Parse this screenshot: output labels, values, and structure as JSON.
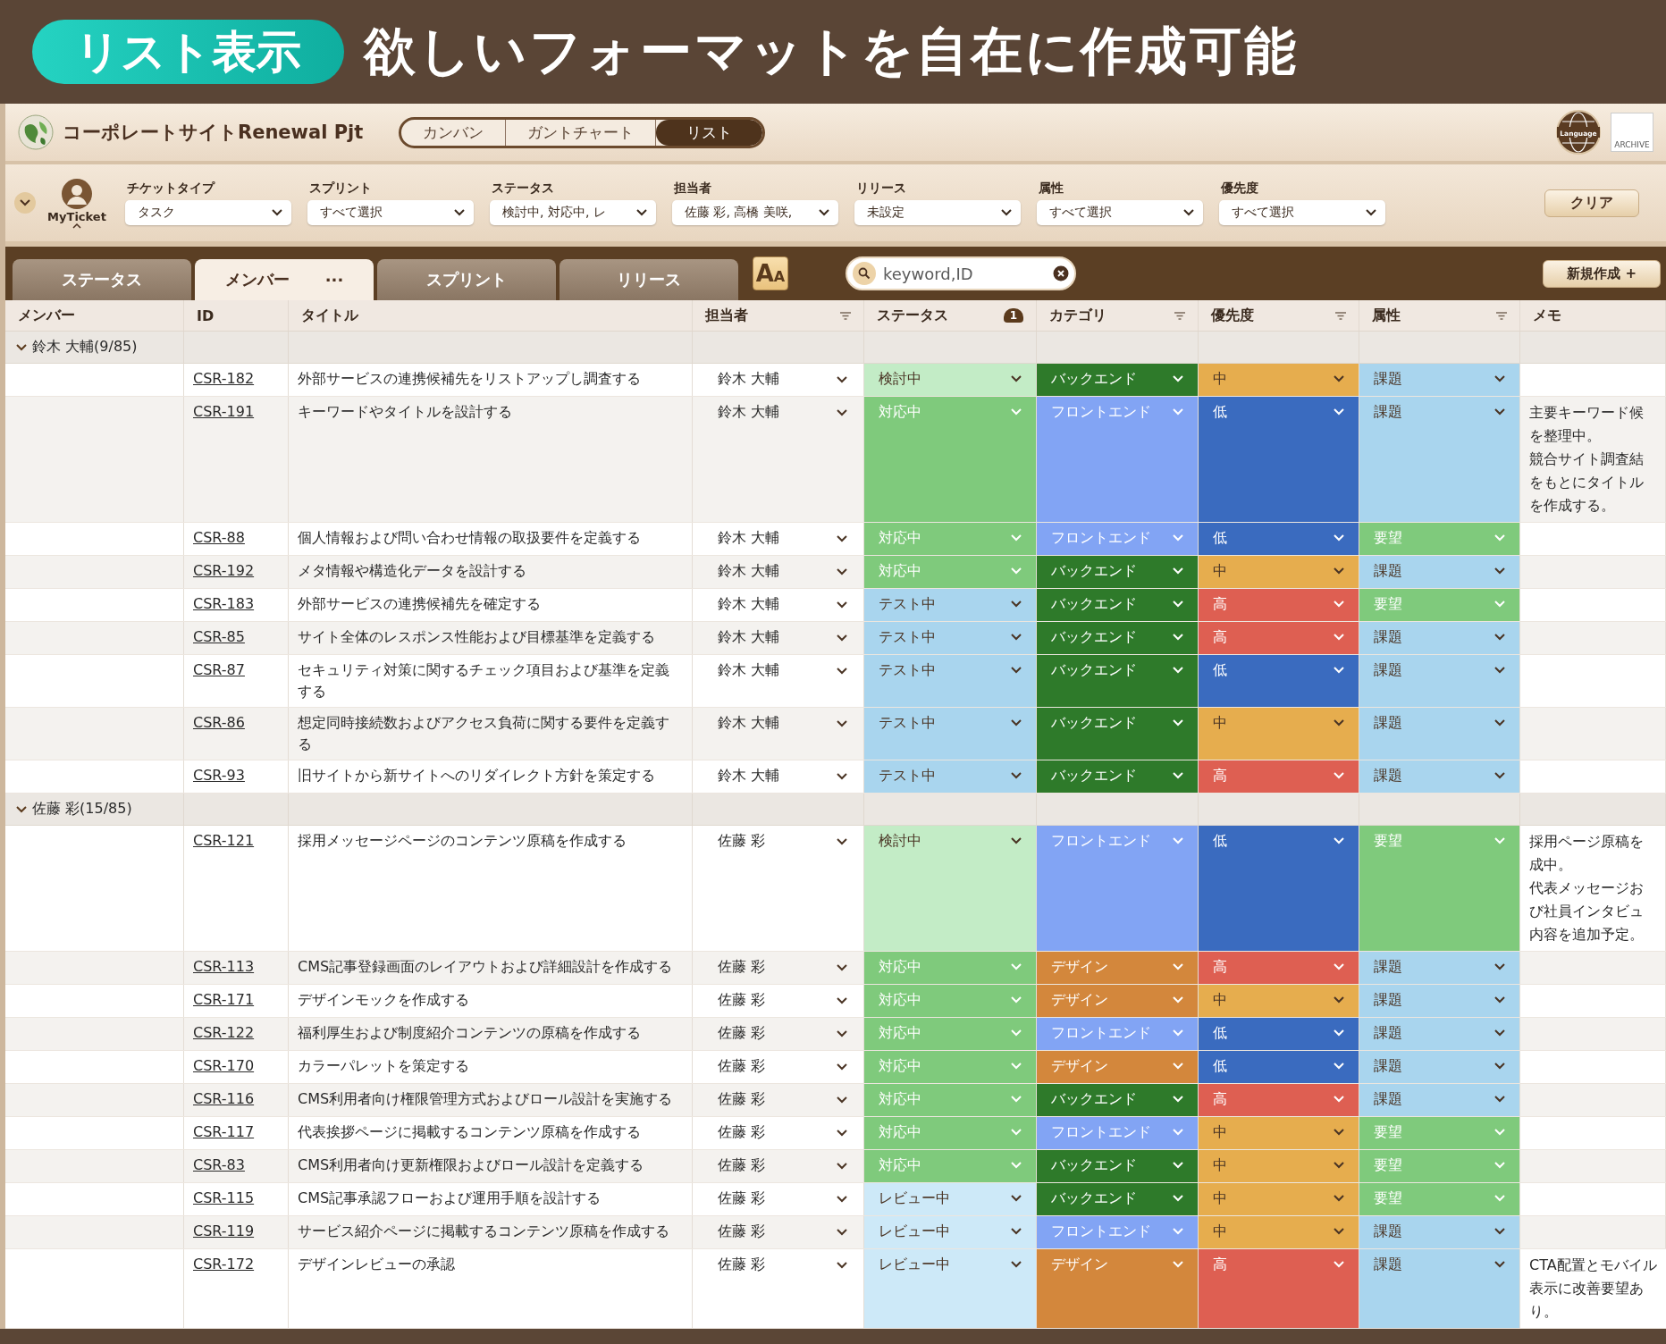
{
  "banner": {
    "tag": "リスト表示",
    "headline": "欲しいフォーマットを自在に作成可能"
  },
  "header": {
    "project": "コーポレートサイトRenewal Pjt",
    "views": [
      {
        "label": "カンバン",
        "selected": false
      },
      {
        "label": "ガントチャート",
        "selected": false
      },
      {
        "label": "リスト",
        "selected": true
      }
    ],
    "language": "Language",
    "archive": "ARCHIVE"
  },
  "filters": {
    "my_ticket": "MyTicket",
    "items": [
      {
        "label": "チケットタイプ",
        "value": "タスク"
      },
      {
        "label": "スプリント",
        "value": "すべて選択"
      },
      {
        "label": "ステータス",
        "value": "検討中, 対応中, レ"
      },
      {
        "label": "担当者",
        "value": "佐藤 彩, 高橋 美咲,"
      },
      {
        "label": "リリース",
        "value": "未設定"
      },
      {
        "label": "属性",
        "value": "すべて選択"
      },
      {
        "label": "優先度",
        "value": "すべて選択"
      }
    ],
    "clear": "クリア"
  },
  "tabs": [
    {
      "label": "ステータス",
      "selected": false
    },
    {
      "label": "メンバー",
      "selected": true,
      "menu": "···"
    },
    {
      "label": "スプリント",
      "selected": false
    },
    {
      "label": "リリース",
      "selected": false
    }
  ],
  "font_button": "AA",
  "search": {
    "placeholder": "keyword,ID"
  },
  "new_button": "新規作成 +",
  "table": {
    "columns": [
      {
        "label": "メンバー",
        "filter": false
      },
      {
        "label": "ID",
        "filter": false
      },
      {
        "label": "タイトル",
        "filter": false
      },
      {
        "label": "担当者",
        "filter": true
      },
      {
        "label": "ステータス",
        "filter": false,
        "badge": "1"
      },
      {
        "label": "カテゴリ",
        "filter": true
      },
      {
        "label": "優先度",
        "filter": true
      },
      {
        "label": "属性",
        "filter": true
      },
      {
        "label": "メモ",
        "filter": false
      }
    ],
    "groups": [
      {
        "label": "鈴木 大輔(9/85)",
        "expanded": true,
        "rows": [
          {
            "id": "CSR-182",
            "title": "外部サービスの連携候補先をリストアップし調査する",
            "assignee": "鈴木 大輔",
            "status": {
              "value": "検討中",
              "color": "#c3ecc6"
            },
            "category": {
              "value": "バックエンド",
              "color": "#2e7a2a"
            },
            "priority": {
              "value": "中",
              "color": "#e6ad4e"
            },
            "attribute": {
              "value": "課題",
              "color": "#a9d5ee"
            }
          },
          {
            "id": "CSR-191",
            "title": "キーワードやタイトルを設計する",
            "assignee": "鈴木 大輔",
            "status": {
              "value": "対応中",
              "color": "#7fca7c"
            },
            "category": {
              "value": "フロントエンド",
              "color": "#82a4f4"
            },
            "priority": {
              "value": "低",
              "color": "#3a6bbf"
            },
            "attribute": {
              "value": "課題",
              "color": "#a9d5ee"
            },
            "memo": [
              "主要キーワード候",
              "を整理中。",
              "競合サイト調査結",
              "をもとにタイトル",
              "を作成する。"
            ]
          },
          {
            "id": "CSR-88",
            "title": "個人情報および問い合わせ情報の取扱要件を定義する",
            "assignee": "鈴木 大輔",
            "status": {
              "value": "対応中",
              "color": "#7fca7c"
            },
            "category": {
              "value": "フロントエンド",
              "color": "#82a4f4"
            },
            "priority": {
              "value": "低",
              "color": "#3a6bbf"
            },
            "attribute": {
              "value": "要望",
              "color": "#7fca7c"
            }
          },
          {
            "id": "CSR-192",
            "title": "メタ情報や構造化データを設計する",
            "assignee": "鈴木 大輔",
            "status": {
              "value": "対応中",
              "color": "#7fca7c"
            },
            "category": {
              "value": "バックエンド",
              "color": "#2e7a2a"
            },
            "priority": {
              "value": "中",
              "color": "#e6ad4e"
            },
            "attribute": {
              "value": "課題",
              "color": "#a9d5ee"
            }
          },
          {
            "id": "CSR-183",
            "title": "外部サービスの連携候補先を確定する",
            "assignee": "鈴木 大輔",
            "status": {
              "value": "テスト中",
              "color": "#a9d5ee"
            },
            "category": {
              "value": "バックエンド",
              "color": "#2e7a2a"
            },
            "priority": {
              "value": "高",
              "color": "#de5f52"
            },
            "attribute": {
              "value": "要望",
              "color": "#7fca7c"
            }
          },
          {
            "id": "CSR-85",
            "title": "サイト全体のレスポンス性能および目標基準を定義する",
            "assignee": "鈴木 大輔",
            "status": {
              "value": "テスト中",
              "color": "#a9d5ee"
            },
            "category": {
              "value": "バックエンド",
              "color": "#2e7a2a"
            },
            "priority": {
              "value": "高",
              "color": "#de5f52"
            },
            "attribute": {
              "value": "課題",
              "color": "#a9d5ee"
            }
          },
          {
            "id": "CSR-87",
            "title": "セキュリティ対策に関するチェック項目および基準を定義する",
            "assignee": "鈴木 大輔",
            "status": {
              "value": "テスト中",
              "color": "#a9d5ee"
            },
            "category": {
              "value": "バックエンド",
              "color": "#2e7a2a"
            },
            "priority": {
              "value": "低",
              "color": "#3a6bbf"
            },
            "attribute": {
              "value": "課題",
              "color": "#a9d5ee"
            }
          },
          {
            "id": "CSR-86",
            "title": "想定同時接続数およびアクセス負荷に関する要件を定義する",
            "assignee": "鈴木 大輔",
            "status": {
              "value": "テスト中",
              "color": "#a9d5ee"
            },
            "category": {
              "value": "バックエンド",
              "color": "#2e7a2a"
            },
            "priority": {
              "value": "中",
              "color": "#e6ad4e"
            },
            "attribute": {
              "value": "課題",
              "color": "#a9d5ee"
            }
          },
          {
            "id": "CSR-93",
            "title": "旧サイトから新サイトへのリダイレクト方針を策定する",
            "assignee": "鈴木 大輔",
            "status": {
              "value": "テスト中",
              "color": "#a9d5ee"
            },
            "category": {
              "value": "バックエンド",
              "color": "#2e7a2a"
            },
            "priority": {
              "value": "高",
              "color": "#de5f52"
            },
            "attribute": {
              "value": "課題",
              "color": "#a9d5ee"
            }
          }
        ]
      },
      {
        "label": "佐藤 彩(15/85)",
        "expanded": true,
        "rows": [
          {
            "id": "CSR-121",
            "title": "採用メッセージページのコンテンツ原稿を作成する",
            "assignee": "佐藤 彩",
            "status": {
              "value": "検討中",
              "color": "#c3ecc6"
            },
            "category": {
              "value": "フロントエンド",
              "color": "#82a4f4"
            },
            "priority": {
              "value": "低",
              "color": "#3a6bbf"
            },
            "attribute": {
              "value": "要望",
              "color": "#7fca7c"
            },
            "memo": [
              "採用ページ原稿を",
              "成中。",
              "代表メッセージお",
              "び社員インタビュ",
              "内容を追加予定。"
            ]
          },
          {
            "id": "CSR-113",
            "title": "CMS記事登録画面のレイアウトおよび詳細設計を作成する",
            "assignee": "佐藤 彩",
            "status": {
              "value": "対応中",
              "color": "#7fca7c"
            },
            "category": {
              "value": "デザイン",
              "color": "#d3873c"
            },
            "priority": {
              "value": "高",
              "color": "#de5f52"
            },
            "attribute": {
              "value": "課題",
              "color": "#a9d5ee"
            }
          },
          {
            "id": "CSR-171",
            "title": "デザインモックを作成する",
            "assignee": "佐藤 彩",
            "status": {
              "value": "対応中",
              "color": "#7fca7c"
            },
            "category": {
              "value": "デザイン",
              "color": "#d3873c"
            },
            "priority": {
              "value": "中",
              "color": "#e6ad4e"
            },
            "attribute": {
              "value": "課題",
              "color": "#a9d5ee"
            }
          },
          {
            "id": "CSR-122",
            "title": "福利厚生および制度紹介コンテンツの原稿を作成する",
            "assignee": "佐藤 彩",
            "status": {
              "value": "対応中",
              "color": "#7fca7c"
            },
            "category": {
              "value": "フロントエンド",
              "color": "#82a4f4"
            },
            "priority": {
              "value": "低",
              "color": "#3a6bbf"
            },
            "attribute": {
              "value": "課題",
              "color": "#a9d5ee"
            }
          },
          {
            "id": "CSR-170",
            "title": "カラーパレットを策定する",
            "assignee": "佐藤 彩",
            "status": {
              "value": "対応中",
              "color": "#7fca7c"
            },
            "category": {
              "value": "デザイン",
              "color": "#d3873c"
            },
            "priority": {
              "value": "低",
              "color": "#3a6bbf"
            },
            "attribute": {
              "value": "課題",
              "color": "#a9d5ee"
            }
          },
          {
            "id": "CSR-116",
            "title": "CMS利用者向け権限管理方式およびロール設計を実施する",
            "assignee": "佐藤 彩",
            "status": {
              "value": "対応中",
              "color": "#7fca7c"
            },
            "category": {
              "value": "バックエンド",
              "color": "#2e7a2a"
            },
            "priority": {
              "value": "高",
              "color": "#de5f52"
            },
            "attribute": {
              "value": "課題",
              "color": "#a9d5ee"
            }
          },
          {
            "id": "CSR-117",
            "title": "代表挨拶ページに掲載するコンテンツ原稿を作成する",
            "assignee": "佐藤 彩",
            "status": {
              "value": "対応中",
              "color": "#7fca7c"
            },
            "category": {
              "value": "フロントエンド",
              "color": "#82a4f4"
            },
            "priority": {
              "value": "中",
              "color": "#e6ad4e"
            },
            "attribute": {
              "value": "要望",
              "color": "#7fca7c"
            }
          },
          {
            "id": "CSR-83",
            "title": "CMS利用者向け更新権限およびロール設計を定義する",
            "assignee": "佐藤 彩",
            "status": {
              "value": "対応中",
              "color": "#7fca7c"
            },
            "category": {
              "value": "バックエンド",
              "color": "#2e7a2a"
            },
            "priority": {
              "value": "中",
              "color": "#e6ad4e"
            },
            "attribute": {
              "value": "要望",
              "color": "#7fca7c"
            }
          },
          {
            "id": "CSR-115",
            "title": "CMS記事承認フローおよび運用手順を設計する",
            "assignee": "佐藤 彩",
            "status": {
              "value": "レビュー中",
              "color": "#cde9f8"
            },
            "category": {
              "value": "バックエンド",
              "color": "#2e7a2a"
            },
            "priority": {
              "value": "中",
              "color": "#e6ad4e"
            },
            "attribute": {
              "value": "要望",
              "color": "#7fca7c"
            }
          },
          {
            "id": "CSR-119",
            "title": "サービス紹介ページに掲載するコンテンツ原稿を作成する",
            "assignee": "佐藤 彩",
            "status": {
              "value": "レビュー中",
              "color": "#cde9f8"
            },
            "category": {
              "value": "フロントエンド",
              "color": "#82a4f4"
            },
            "priority": {
              "value": "中",
              "color": "#e6ad4e"
            },
            "attribute": {
              "value": "課題",
              "color": "#a9d5ee"
            }
          },
          {
            "id": "CSR-172",
            "title": "デザインレビューの承認",
            "assignee": "佐藤 彩",
            "status": {
              "value": "レビュー中",
              "color": "#cde9f8"
            },
            "category": {
              "value": "デザイン",
              "color": "#d3873c"
            },
            "priority": {
              "value": "高",
              "color": "#de5f52"
            },
            "attribute": {
              "value": "課題",
              "color": "#a9d5ee"
            },
            "memo": [
              "CTA配置とモバイル",
              "表示に改善要望あ",
              "り。"
            ]
          }
        ]
      }
    ]
  }
}
